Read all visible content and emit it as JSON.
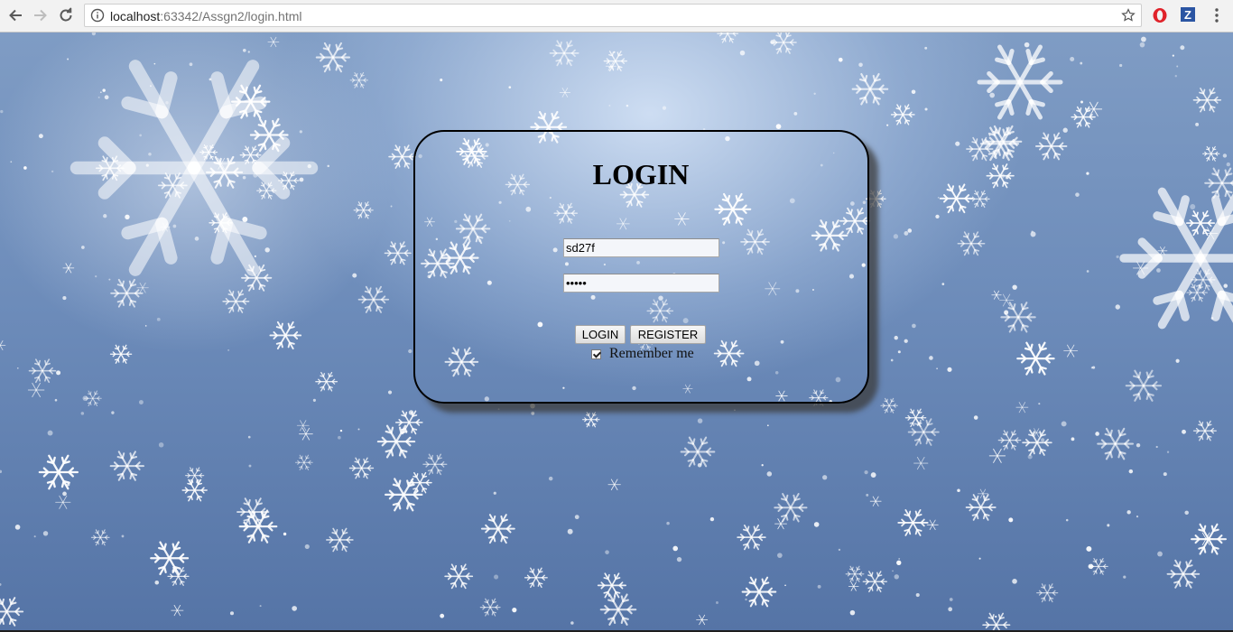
{
  "browser": {
    "url_host": "localhost",
    "url_path": ":63342/Assgn2/login.html",
    "icons": {
      "back": "arrow-left-icon",
      "forward": "arrow-right-icon",
      "reload": "reload-icon",
      "info": "info-icon",
      "bookmark": "star-icon",
      "opera_extension": "opera-icon",
      "z_extension": "z-extension-icon",
      "menu": "vertical-dots-icon"
    },
    "z_extension_label": "Z"
  },
  "login_form": {
    "title": "LOGIN",
    "username_value": "sd27f",
    "password_value": "•••••",
    "login_button": "LOGIN",
    "register_button": "REGISTER",
    "remember_label": "Remember me",
    "remember_checked": true
  },
  "colors": {
    "background_top": "#7f9cc4",
    "background_bottom": "#5574a6",
    "card_border": "#000000"
  }
}
